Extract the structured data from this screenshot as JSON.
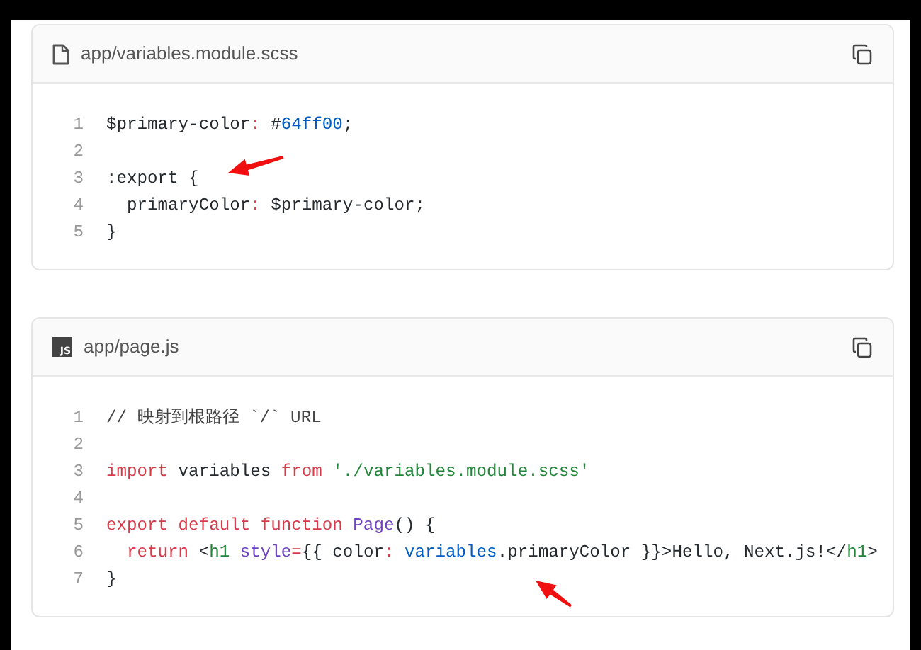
{
  "code_blocks": [
    {
      "file": {
        "name": "app/variables.module.scss"
      },
      "lines": [
        {
          "number": "1",
          "tokens": [
            {
              "text": "$primary-color",
              "kind": "plain"
            },
            {
              "text": ": ",
              "kind": "operator"
            },
            {
              "text": "#",
              "kind": "plain"
            },
            {
              "text": "64ff00",
              "kind": "number"
            },
            {
              "text": ";",
              "kind": "plain"
            }
          ]
        },
        {
          "number": "2"
        },
        {
          "number": "3",
          "tokens": [
            {
              "text": ":export {",
              "kind": "plain"
            }
          ]
        },
        {
          "number": "4",
          "tokens": [
            {
              "text": "  primaryColor",
              "kind": "plain"
            },
            {
              "text": ": ",
              "kind": "operator"
            },
            {
              "text": "$primary-color;",
              "kind": "plain"
            }
          ]
        },
        {
          "number": "5",
          "tokens": [
            {
              "text": "}",
              "kind": "plain"
            }
          ]
        }
      ]
    },
    {
      "file": {
        "name": "app/page.js",
        "icon_text": "JS"
      },
      "lines": [
        {
          "number": "1",
          "tokens": [
            {
              "text": "// 映射到根路径 `/` URL",
              "kind": "comment"
            }
          ]
        },
        {
          "number": "2"
        },
        {
          "number": "3",
          "tokens": [
            {
              "text": "import",
              "kind": "keyword"
            },
            {
              "text": " variables ",
              "kind": "plain"
            },
            {
              "text": "from",
              "kind": "keyword"
            },
            {
              "text": " './variables.module.scss'",
              "kind": "string"
            }
          ]
        },
        {
          "number": "4"
        },
        {
          "number": "5",
          "tokens": [
            {
              "text": "export default function",
              "kind": "keyword"
            },
            {
              "text": " Page",
              "kind": "function"
            },
            {
              "text": "() {",
              "kind": "plain"
            }
          ]
        },
        {
          "number": "6",
          "tokens": [
            {
              "text": "  return",
              "kind": "keyword"
            },
            {
              "text": " <",
              "kind": "plain"
            },
            {
              "text": "h1",
              "kind": "tag"
            },
            {
              "text": " style",
              "kind": "function"
            },
            {
              "text": "=",
              "kind": "operator"
            },
            {
              "text": "{{ color",
              "kind": "plain"
            },
            {
              "text": ": ",
              "kind": "operator"
            },
            {
              "text": "variables",
              "kind": "variable"
            },
            {
              "text": ".primaryColor }}>Hello, Next.js!</",
              "kind": "plain"
            },
            {
              "text": "h1",
              "kind": "tag"
            },
            {
              "text": ">",
              "kind": "plain"
            }
          ]
        },
        {
          "number": "7",
          "tokens": [
            {
              "text": "}",
              "kind": "plain"
            }
          ]
        }
      ]
    }
  ]
}
